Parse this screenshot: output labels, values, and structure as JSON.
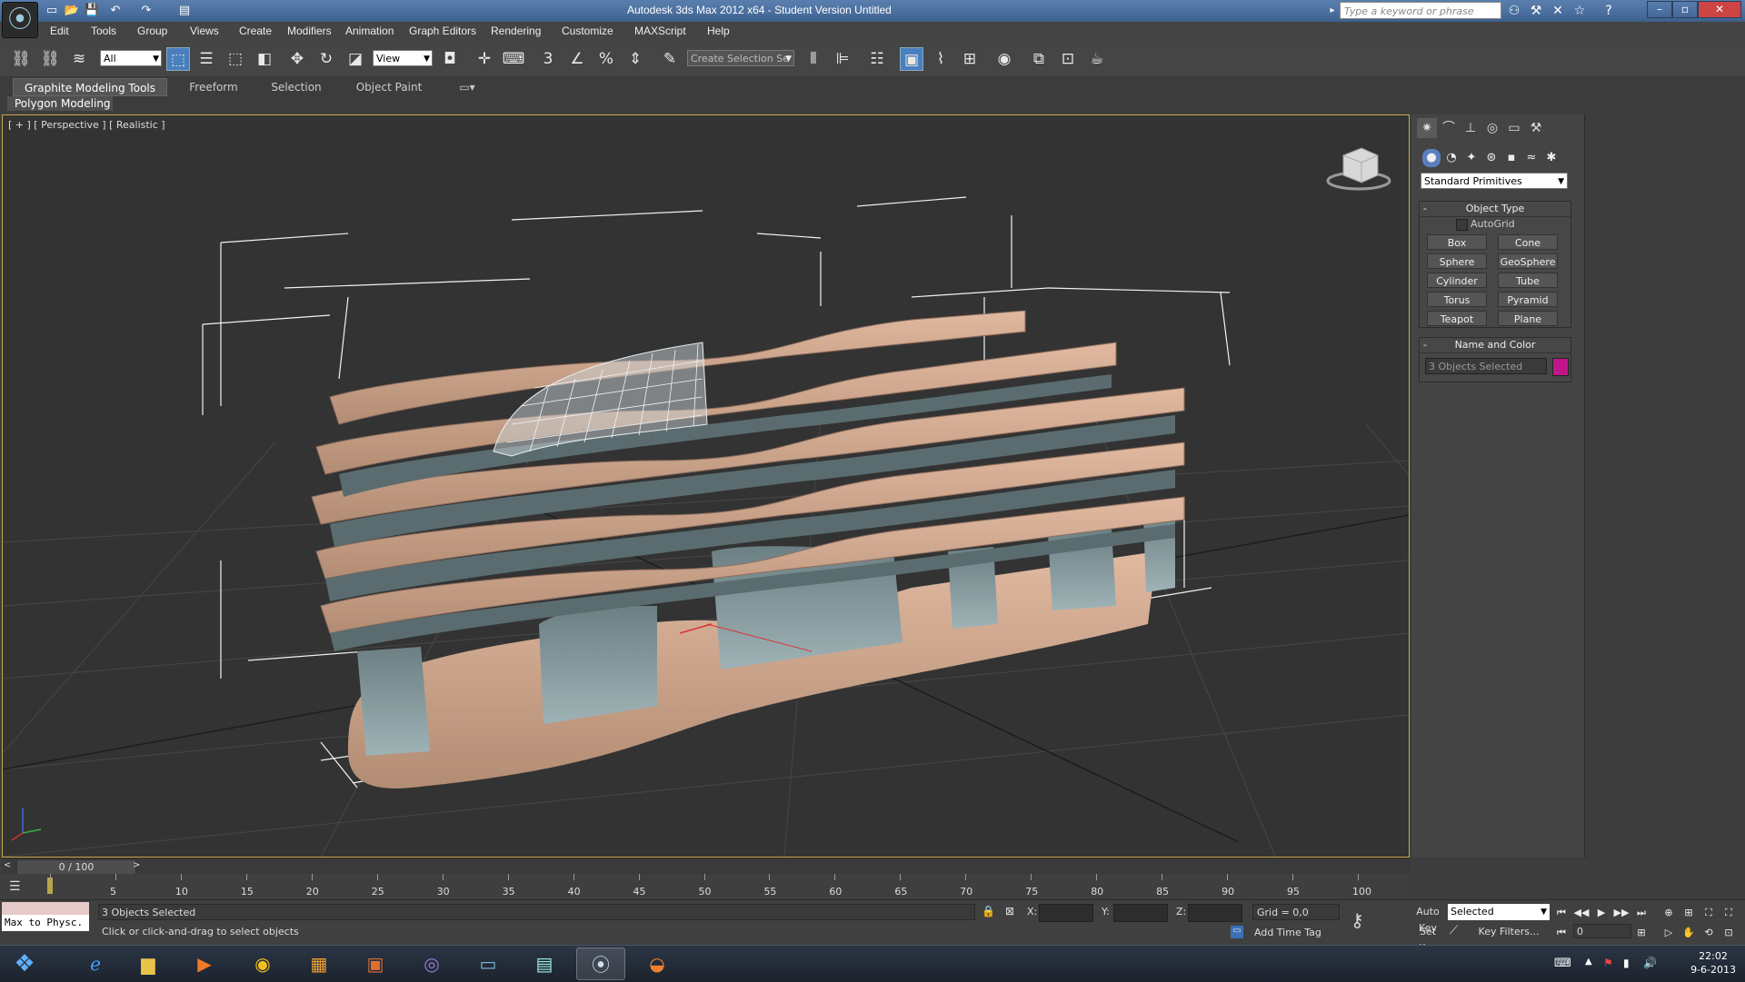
{
  "titlebar": {
    "title": "Autodesk 3ds Max  2012 x64  - Student Version   Untitled",
    "search_placeholder": "Type a keyword or phrase"
  },
  "menu": [
    "Edit",
    "Tools",
    "Group",
    "Views",
    "Create",
    "Modifiers",
    "Animation",
    "Graph Editors",
    "Rendering",
    "Customize",
    "MAXScript",
    "Help"
  ],
  "toolbar": {
    "filter_value": "All",
    "refcoord_value": "View",
    "selection_set_placeholder": "Create Selection Se"
  },
  "ribbon": {
    "tabs": [
      "Graphite Modeling Tools",
      "Freeform",
      "Selection",
      "Object Paint"
    ],
    "panel_label": "Polygon Modeling"
  },
  "viewport": {
    "label": "[ + ] [ Perspective ] [ Realistic ]"
  },
  "command_panel": {
    "primitive_type": "Standard Primitives",
    "object_type_title": "Object Type",
    "autogrid_label": "AutoGrid",
    "buttons": [
      "Box",
      "Cone",
      "Sphere",
      "GeoSphere",
      "Cylinder",
      "Tube",
      "Torus",
      "Pyramid",
      "Teapot",
      "Plane"
    ],
    "name_color_title": "Name and Color",
    "name_value": "3 Objects Selected",
    "object_color": "#c0168a"
  },
  "timeline": {
    "frame_label": "0 / 100",
    "ticks": [
      "5",
      "10",
      "15",
      "20",
      "25",
      "30",
      "35",
      "40",
      "45",
      "50",
      "55",
      "60",
      "65",
      "70",
      "75",
      "80",
      "85",
      "90",
      "95",
      "100"
    ]
  },
  "status": {
    "maxscript_text": "Max to Physc.",
    "selection_text": "3 Objects Selected",
    "prompt_text": "Click or click-and-drag to select objects",
    "x_label": "X:",
    "y_label": "Y:",
    "z_label": "Z:",
    "grid_text": "Grid = 0,0",
    "add_time_tag": "Add Time Tag",
    "auto_key": "Auto Key",
    "set_key": "Set Key",
    "key_mode_value": "Selected",
    "key_filters": "Key Filters...",
    "frame_value": "0"
  },
  "taskbar": {
    "time": "22:02",
    "date": "9-6-2013"
  }
}
